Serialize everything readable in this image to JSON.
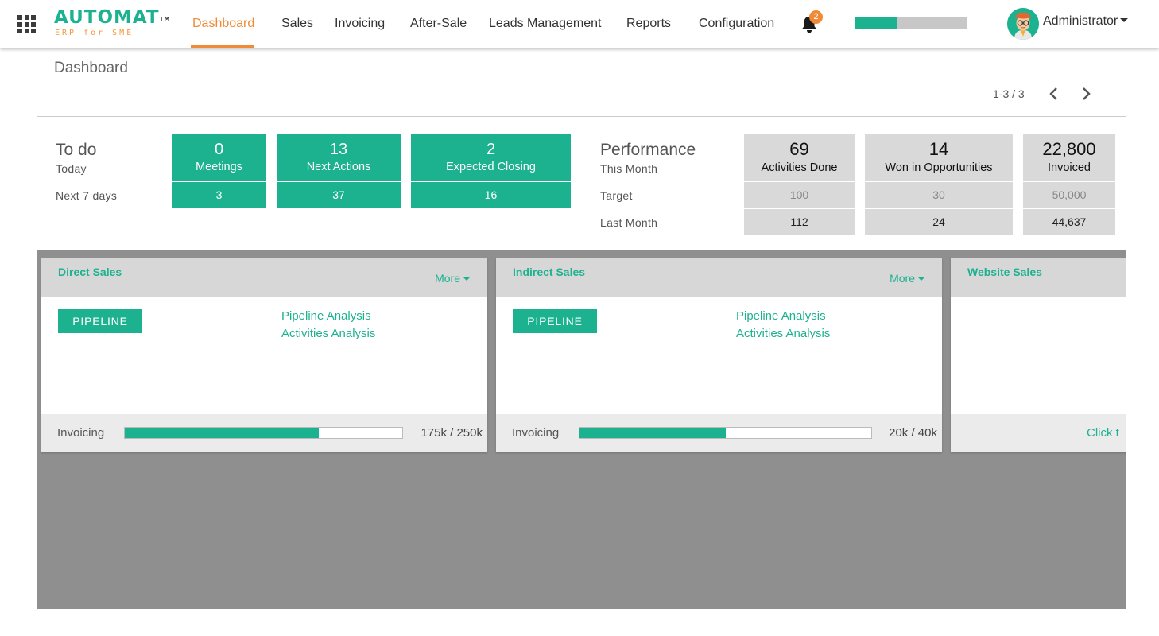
{
  "colors": {
    "accent": "#1db28f",
    "active_nav": "#ef8a36",
    "kanban_bg": "#8f8f8f",
    "perf_box": "#d9d9d9"
  },
  "logo": {
    "main": "AUTOMAT",
    "tm": "TM",
    "sub": "ERP for SME"
  },
  "nav": {
    "dashboard": "Dashboard",
    "sales": "Sales",
    "invoicing": "Invoicing",
    "after_sale": "After-Sale",
    "leads": "Leads Management",
    "reports": "Reports",
    "configuration": "Configuration"
  },
  "notifications": {
    "count": "2",
    "icon": "bell-icon"
  },
  "top_progress": {
    "fraction": 0.375
  },
  "user": {
    "name": "Administrator"
  },
  "page": {
    "title": "Dashboard",
    "pager": "1-3 / 3"
  },
  "todo": {
    "title": "To do",
    "today_label": "Today",
    "next7_label": "Next 7 days",
    "items": [
      {
        "today": "0",
        "label": "Meetings",
        "next7": "3"
      },
      {
        "today": "13",
        "label": "Next Actions",
        "next7": "37"
      },
      {
        "today": "2",
        "label": "Expected Closing",
        "next7": "16"
      }
    ]
  },
  "performance": {
    "title": "Performance",
    "this_month_label": "This Month",
    "target_label": "Target",
    "last_month_label": "Last Month",
    "items": [
      {
        "value": "69",
        "label": "Activities Done",
        "target": "100",
        "last": "112"
      },
      {
        "value": "14",
        "label": "Won in Opportunities",
        "target": "30",
        "last": "24"
      },
      {
        "value": "22,800",
        "label": "Invoiced",
        "target": "50,000",
        "last": "44,637"
      }
    ]
  },
  "teams": [
    {
      "name": "Direct Sales",
      "more": "More",
      "pipeline": "PIPELINE",
      "link1": "Pipeline Analysis",
      "link2": "Activities Analysis",
      "invoicing_label": "Invoicing",
      "invoicing_value": "175k / 250k",
      "invoicing_fraction": 0.7
    },
    {
      "name": "Indirect Sales",
      "more": "More",
      "pipeline": "PIPELINE",
      "link1": "Pipeline Analysis",
      "link2": "Activities Analysis",
      "invoicing_label": "Invoicing",
      "invoicing_value": "20k / 40k",
      "invoicing_fraction": 0.5
    },
    {
      "name": "Website Sales",
      "footer_link": "Click t"
    }
  ]
}
